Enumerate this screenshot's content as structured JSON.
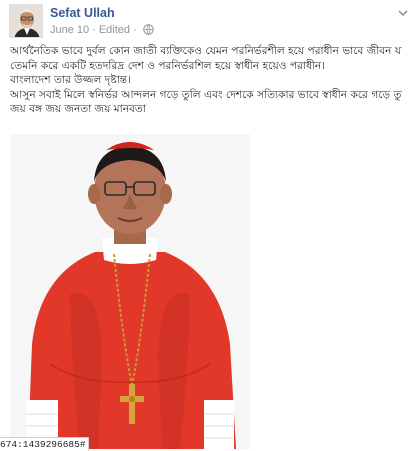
{
  "post": {
    "author_name": "Sefat Ullah",
    "timestamp": "June 10",
    "edited_label": "Edited",
    "separator": "·",
    "privacy_icon": "globe-icon",
    "options_icon": "chevron-down-icon",
    "body_lines": [
      "আর্থনৈতিক ভাবে দুর্বল কোন জাতী ব্যক্তিকেও যেমন পরনির্ভরশীল হয়ে পরাধীন ভাবে জীবন যাপন করতে হয়",
      "তেমনি করে একটি হতদরিদ্র দেশ ও পরনির্ভরশিল হয়ে স্বাধীন হয়েও পরাধীন।",
      "বাংলাদেশ তার উজ্জল দৃষ্টান্ত।",
      "আসুন সবাই মিলে স্বনির্ভর আন্দলন গড়ে তুলি এবং দেশকে সত্যিকার ভাবে স্বাধীন করে গড়ে তুলি।",
      "জয় বঙ্গ জয় জনতা জয় মানবতা"
    ],
    "photo_subject": "cardinal in red vestments with pectoral cross"
  },
  "overlay": {
    "id_text": "674:1439296685#"
  },
  "colors": {
    "author_link": "#3b5998",
    "meta_text": "#90949c",
    "vestment_red": "#e1382a"
  }
}
